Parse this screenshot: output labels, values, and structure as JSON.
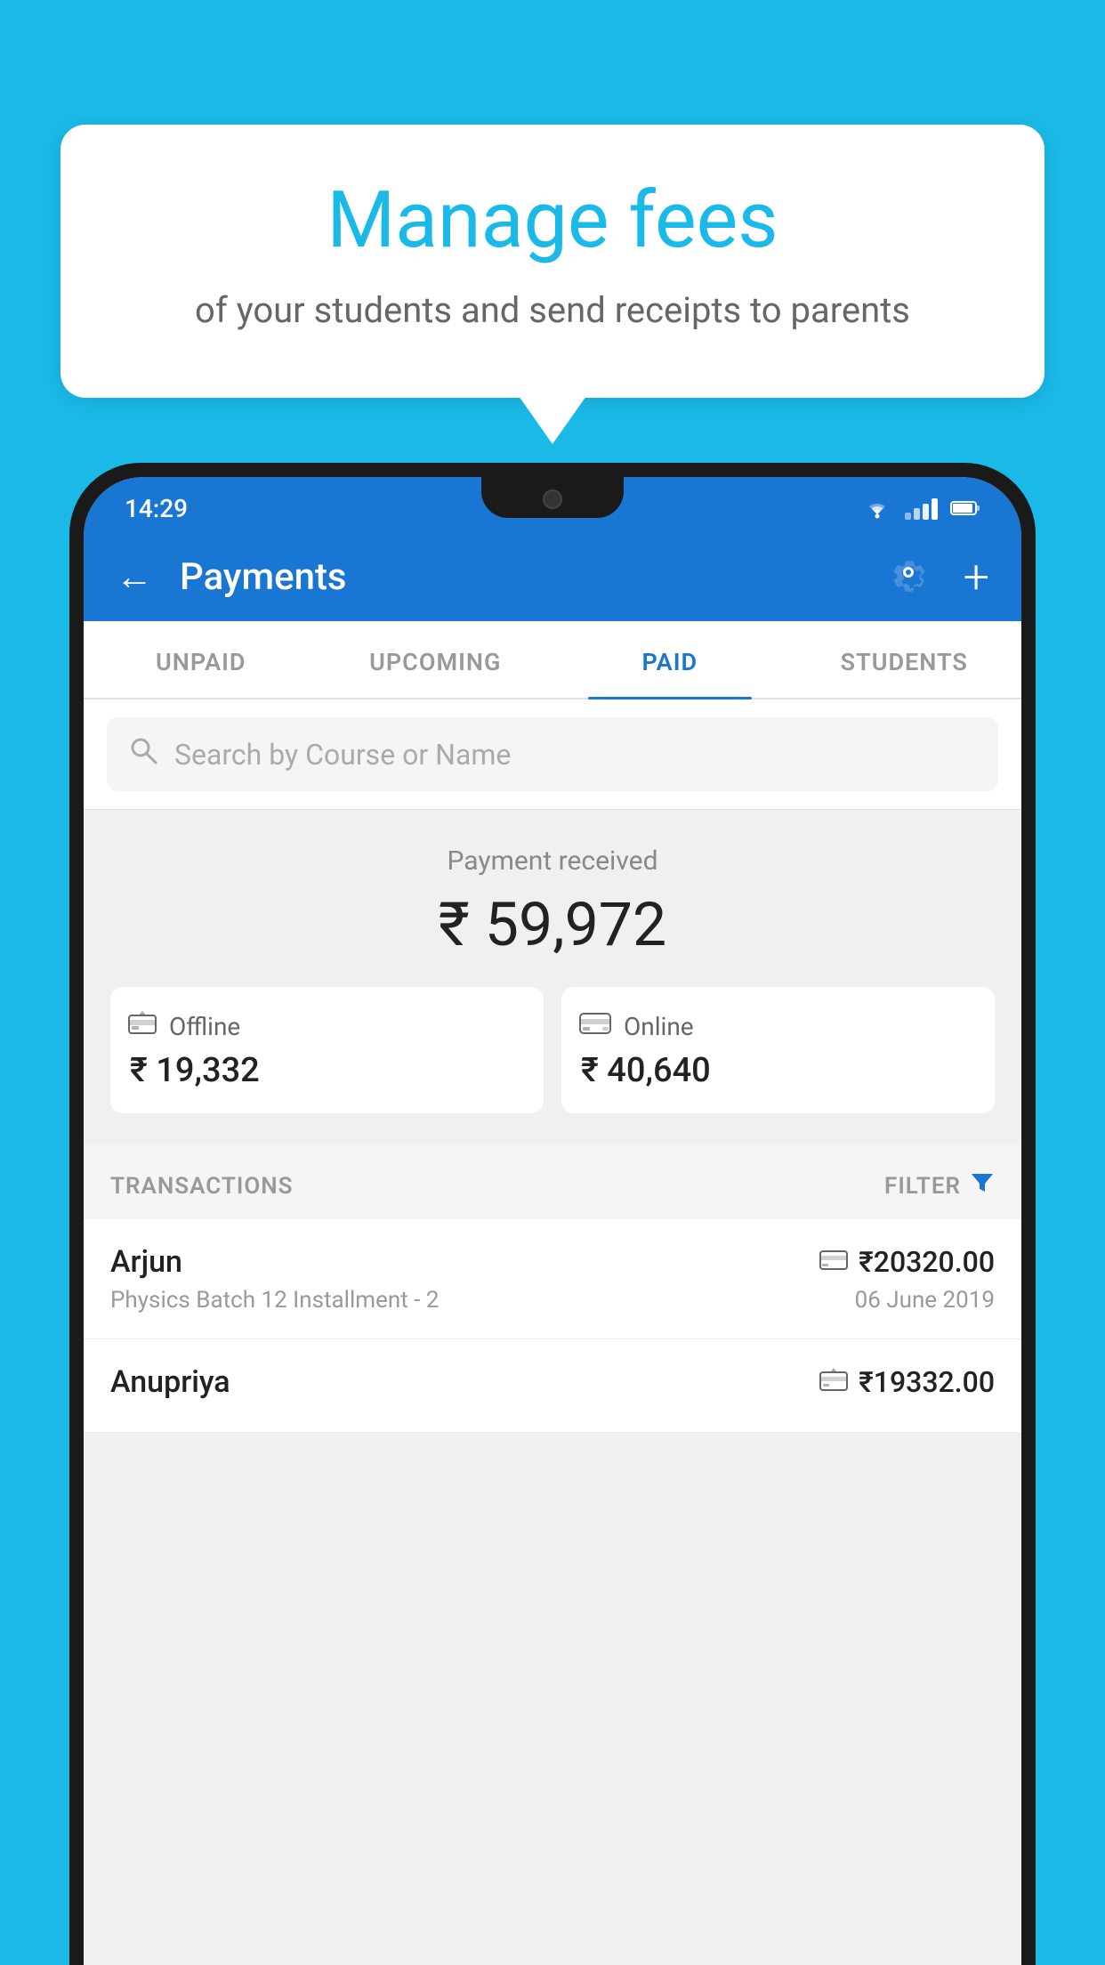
{
  "background": {
    "color": "#1ab9e8"
  },
  "speech_bubble": {
    "title": "Manage fees",
    "subtitle": "of your students and send receipts to parents"
  },
  "status_bar": {
    "time": "14:29",
    "wifi": "▼",
    "battery": "▮"
  },
  "header": {
    "title": "Payments",
    "back_label": "←",
    "gear_label": "⚙",
    "plus_label": "+"
  },
  "tabs": [
    {
      "label": "UNPAID",
      "active": false
    },
    {
      "label": "UPCOMING",
      "active": false
    },
    {
      "label": "PAID",
      "active": true
    },
    {
      "label": "STUDENTS",
      "active": false
    }
  ],
  "search": {
    "placeholder": "Search by Course or Name"
  },
  "payment_summary": {
    "label": "Payment received",
    "total": "₹ 59,972",
    "offline": {
      "type": "Offline",
      "amount": "₹ 19,332"
    },
    "online": {
      "type": "Online",
      "amount": "₹ 40,640"
    }
  },
  "transactions": {
    "label": "TRANSACTIONS",
    "filter_label": "FILTER",
    "items": [
      {
        "name": "Arjun",
        "detail": "Physics Batch 12 Installment - 2",
        "amount": "₹20320.00",
        "date": "06 June 2019",
        "payment_type": "online"
      },
      {
        "name": "Anupriya",
        "detail": "",
        "amount": "₹19332.00",
        "date": "",
        "payment_type": "offline"
      }
    ]
  }
}
